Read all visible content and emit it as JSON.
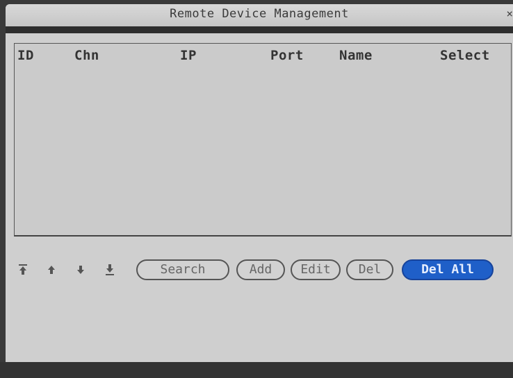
{
  "window": {
    "title": "Remote Device Management",
    "close_glyph": "×"
  },
  "table": {
    "columns": [
      "ID",
      "Chn",
      "IP",
      "Port",
      "Name",
      "Select"
    ],
    "rows": []
  },
  "toolbar": {
    "nav_icons": [
      "first-page-icon",
      "prev-page-icon",
      "next-page-icon",
      "last-page-icon"
    ],
    "buttons": {
      "search": "Search",
      "add": "Add",
      "edit": "Edit",
      "del": "Del",
      "del_all": "Del All"
    },
    "focused_button": "del_all"
  },
  "colors": {
    "window_bg": "#cfcfcf",
    "focus_button": "#1f5fc8"
  }
}
